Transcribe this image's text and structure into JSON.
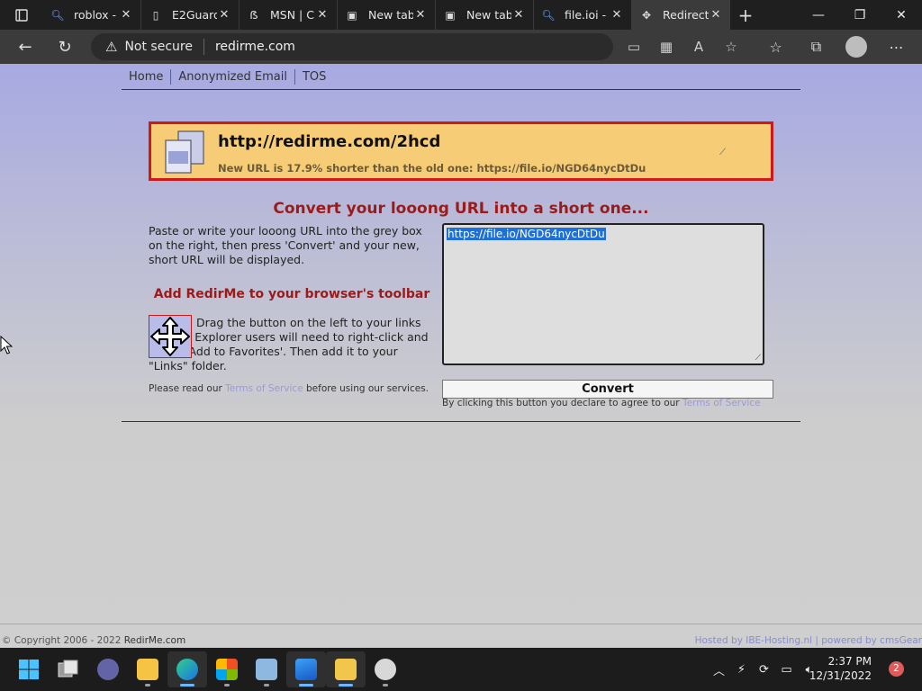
{
  "tabs": [
    {
      "title": "roblox -",
      "icon": "search-icon"
    },
    {
      "title": "E2Guard",
      "icon": "document-icon"
    },
    {
      "title": "MSN | C",
      "icon": "msn-icon"
    },
    {
      "title": "New tab",
      "icon": "newtab-icon"
    },
    {
      "title": "New tab",
      "icon": "newtab-icon"
    },
    {
      "title": "file.ioi -",
      "icon": "search-icon"
    },
    {
      "title": "Redirect",
      "icon": "redirect-icon"
    }
  ],
  "address": {
    "security": "Not secure",
    "url": "redirme.com"
  },
  "nav": {
    "home": "Home",
    "anon": "Anonymized Email",
    "tos": "TOS"
  },
  "result": {
    "short_url": "http://redirme.com/2hcd",
    "info": "New URL is 17.9% shorter than the old one: https://file.io/NGD64nycDtDu"
  },
  "main": {
    "headline": "Convert your looong URL into a short one...",
    "instructions": "Paste or write your looong URL into the grey box on the right, then press 'Convert' and your new, short URL will be displayed.",
    "toolbar_heading": "Add RedirMe to your browser's toolbar",
    "drag_text": "Drag the button on the left to your links toolbar. Explorer users will need to right-click and select 'Add to Favorites'. Then add it to your \"Links\" folder.",
    "tos_prefix": "Please read our",
    "tos_link": "Terms of Service",
    "tos_suffix": "before using our services.",
    "url_value": "https://file.io/NGD64nycDtDu",
    "convert_label": "Convert",
    "agree_prefix": "By clicking this button you declare to agree to our",
    "agree_link": "Terms of Service"
  },
  "footer": {
    "copyright": "© Copyright 2006 - 2022",
    "site": "RedirMe.com",
    "hosted": "Hosted by IBE-Hosting.nl",
    "sep": "|",
    "powered": "powered by cmsGear"
  },
  "taskbar": {
    "time": "2:37 PM",
    "date": "12/31/2022",
    "notifications": "2"
  },
  "colors": {
    "accent_red": "#9b1b1b",
    "result_bg": "#f6cd76",
    "link": "#9a9ad6"
  }
}
